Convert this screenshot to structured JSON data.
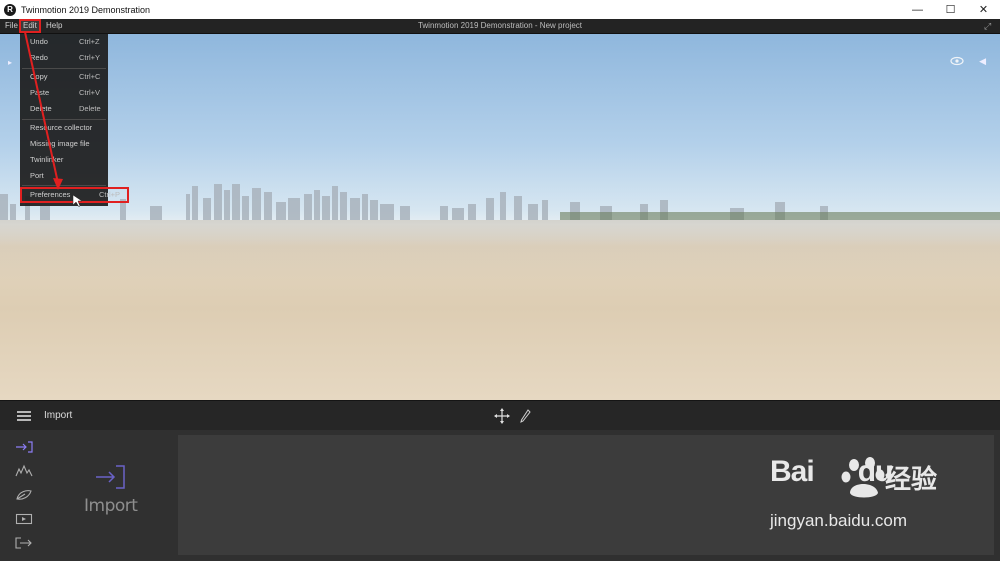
{
  "window": {
    "title": "Twinmotion 2019 Demonstration",
    "logo": "R",
    "controls": [
      "minimize-icon",
      "maximize-icon",
      "close-icon"
    ]
  },
  "menubar": {
    "file": "File",
    "edit": "Edit",
    "help": "Help",
    "app_title": "Twinmotion 2019 Demonstration - New project"
  },
  "edit_menu": {
    "items": [
      {
        "label": "Undo",
        "shortcut": "Ctrl+Z"
      },
      {
        "label": "Redo",
        "shortcut": "Ctrl+Y"
      },
      {
        "label": "Copy",
        "shortcut": "Ctrl+C"
      },
      {
        "label": "Paste",
        "shortcut": "Ctrl+V"
      },
      {
        "label": "Delete",
        "shortcut": "Delete"
      },
      {
        "label": "Resource collector",
        "shortcut": ""
      },
      {
        "label": "Missing image file",
        "shortcut": ""
      },
      {
        "label": "Twinlinker",
        "shortcut": ""
      },
      {
        "label": "Port",
        "shortcut": ""
      },
      {
        "label": "Preferences",
        "shortcut": "Ctrl+P"
      }
    ]
  },
  "bottom_bar": {
    "title": "Import",
    "icons": [
      "menu-icon",
      "move-icon",
      "pen-icon"
    ]
  },
  "bottom_panel": {
    "side_icons": [
      "import-icon",
      "landscape-icon",
      "leaf-icon",
      "media-icon",
      "export-icon"
    ],
    "import_label": "Import"
  },
  "watermark": {
    "logo": "Bai",
    "logo_suffix": "du",
    "cn": "经验",
    "url": "jingyan.baidu.com"
  },
  "colors": {
    "highlight": "#e02020",
    "accent": "#7b6cf0"
  }
}
